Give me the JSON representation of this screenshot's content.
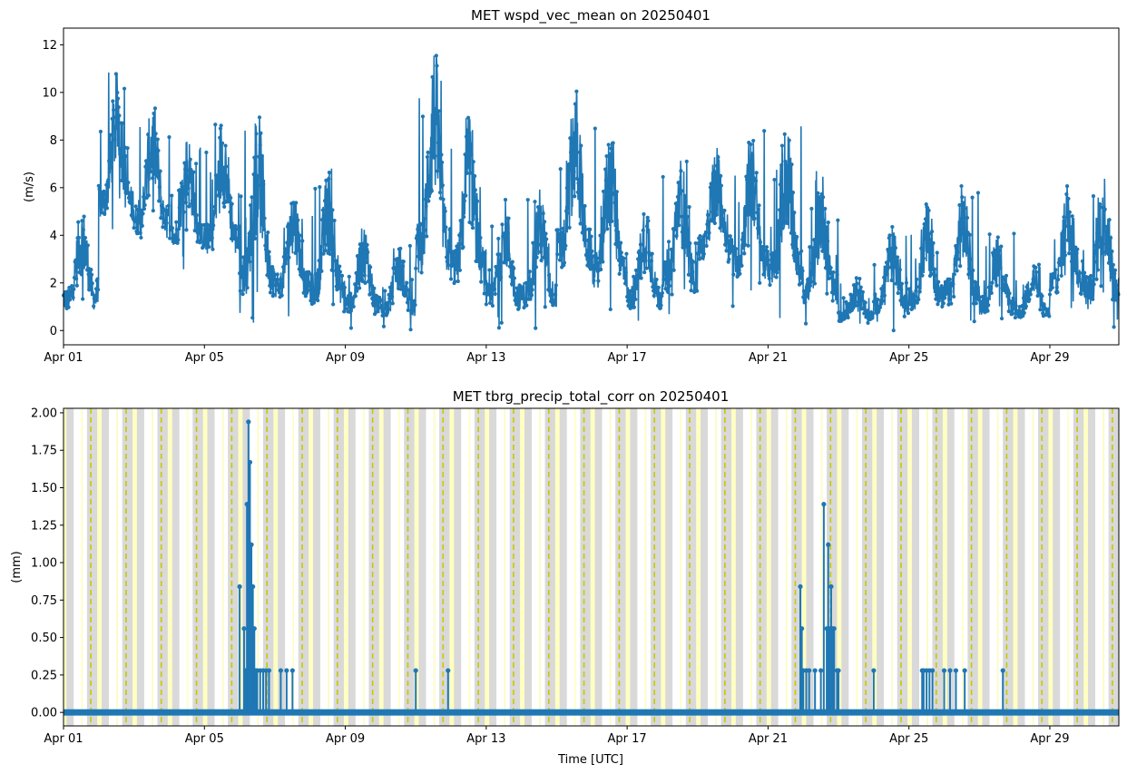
{
  "chart_data": [
    {
      "type": "line",
      "title": "MET wspd_vec_mean on 20250401",
      "xlabel": "",
      "ylabel": "(m/s)",
      "xlim": [
        "2025-04-01",
        "2025-04-30T23:00"
      ],
      "ylim": [
        -0.6,
        12.7
      ],
      "x_ticks": [
        "Apr 01",
        "Apr 05",
        "Apr 09",
        "Apr 13",
        "Apr 17",
        "Apr 21",
        "Apr 25",
        "Apr 29"
      ],
      "y_ticks": [
        "0",
        "2",
        "4",
        "6",
        "8",
        "10",
        "12"
      ],
      "marker": "dot",
      "grid": false,
      "color": "#1f77b4",
      "envelope": {
        "note": "approximate daily range of the 1-minute series",
        "x": [
          "2025-04-01",
          "2025-04-02",
          "2025-04-03",
          "2025-04-04",
          "2025-04-05",
          "2025-04-06",
          "2025-04-07",
          "2025-04-08",
          "2025-04-09",
          "2025-04-10",
          "2025-04-11",
          "2025-04-12",
          "2025-04-13",
          "2025-04-14",
          "2025-04-15",
          "2025-04-16",
          "2025-04-17",
          "2025-04-18",
          "2025-04-19",
          "2025-04-20",
          "2025-04-21",
          "2025-04-22",
          "2025-04-23",
          "2025-04-24",
          "2025-04-25",
          "2025-04-26",
          "2025-04-27",
          "2025-04-28",
          "2025-04-29",
          "2025-04-30"
        ],
        "low": [
          0.0,
          3.5,
          3.0,
          2.5,
          2.0,
          0.0,
          0.5,
          0.0,
          0.0,
          0.0,
          0.5,
          0.5,
          0.0,
          0.0,
          1.0,
          0.5,
          0.0,
          0.5,
          2.0,
          1.0,
          0.5,
          0.0,
          0.0,
          0.0,
          0.0,
          0.0,
          0.0,
          0.0,
          0.5,
          0.0
        ],
        "high": [
          5.2,
          10.9,
          9.6,
          8.3,
          9.2,
          9.2,
          6.1,
          6.9,
          4.5,
          3.6,
          12.1,
          9.3,
          5.6,
          6.0,
          10.4,
          8.6,
          5.5,
          7.3,
          7.8,
          8.4,
          8.8,
          6.7,
          2.3,
          4.4,
          5.4,
          6.2,
          4.2,
          3.0,
          6.4,
          6.8
        ]
      }
    },
    {
      "type": "line",
      "title": "MET tbrg_precip_total_corr on 20250401",
      "xlabel": "Time [UTC]",
      "ylabel": "(mm)",
      "xlim": [
        "2025-04-01",
        "2025-04-30T23:00"
      ],
      "ylim": [
        -0.09,
        2.03
      ],
      "x_ticks": [
        "Apr 01",
        "Apr 05",
        "Apr 09",
        "Apr 13",
        "Apr 17",
        "Apr 21",
        "Apr 25",
        "Apr 29"
      ],
      "y_ticks": [
        "0.00",
        "0.25",
        "0.50",
        "0.75",
        "1.00",
        "1.25",
        "1.50",
        "1.75",
        "2.00"
      ],
      "marker": "dot",
      "grid": false,
      "color": "#1f77b4",
      "background": {
        "night_color": "#d9d9d9",
        "twilight_color": "#ffffc0",
        "noon_line_color": "#c8c800",
        "day_boundaries_note": "alternating day/night bands each day with a dashed line at solar noon"
      },
      "x": [
        "2025-04-06T00:00",
        "2025-04-06T03:00",
        "2025-04-06T04:00",
        "2025-04-06T05:00",
        "2025-04-06T06:00",
        "2025-04-06T07:00",
        "2025-04-06T08:00",
        "2025-04-06T09:00",
        "2025-04-06T10:00",
        "2025-04-06T11:00",
        "2025-04-06T12:00",
        "2025-04-06T14:00",
        "2025-04-06T16:00",
        "2025-04-06T18:00",
        "2025-04-06T20:00",
        "2025-04-07T04:00",
        "2025-04-07T08:00",
        "2025-04-07T12:00",
        "2025-04-11T00:00",
        "2025-04-11T22:00",
        "2025-04-21T22:00",
        "2025-04-21T23:00",
        "2025-04-22T00:00",
        "2025-04-22T02:00",
        "2025-04-22T04:00",
        "2025-04-22T08:00",
        "2025-04-22T12:00",
        "2025-04-22T14:00",
        "2025-04-22T16:00",
        "2025-04-22T17:00",
        "2025-04-22T18:00",
        "2025-04-22T19:00",
        "2025-04-22T20:00",
        "2025-04-22T21:00",
        "2025-04-22T23:00",
        "2025-04-23T00:00",
        "2025-04-24T00:00",
        "2025-04-25T09:00",
        "2025-04-25T10:00",
        "2025-04-25T12:00",
        "2025-04-25T14:00",
        "2025-04-25T16:00",
        "2025-04-26T00:00",
        "2025-04-26T04:00",
        "2025-04-26T08:00",
        "2025-04-26T14:00",
        "2025-04-27T16:00"
      ],
      "y": [
        0.84,
        0.56,
        0.28,
        1.39,
        1.94,
        1.67,
        1.12,
        0.84,
        0.56,
        0.28,
        0.28,
        0.28,
        0.28,
        0.28,
        0.28,
        0.28,
        0.28,
        0.28,
        0.28,
        0.28,
        0.84,
        0.56,
        0.28,
        0.28,
        0.28,
        0.28,
        0.28,
        1.39,
        0.56,
        1.12,
        0.56,
        0.84,
        0.56,
        0.56,
        0.28,
        0.28,
        0.28,
        0.28,
        0.28,
        0.28,
        0.28,
        0.28,
        0.28,
        0.28,
        0.28,
        0.28,
        0.28
      ],
      "baseline_value": 0.0
    }
  ]
}
